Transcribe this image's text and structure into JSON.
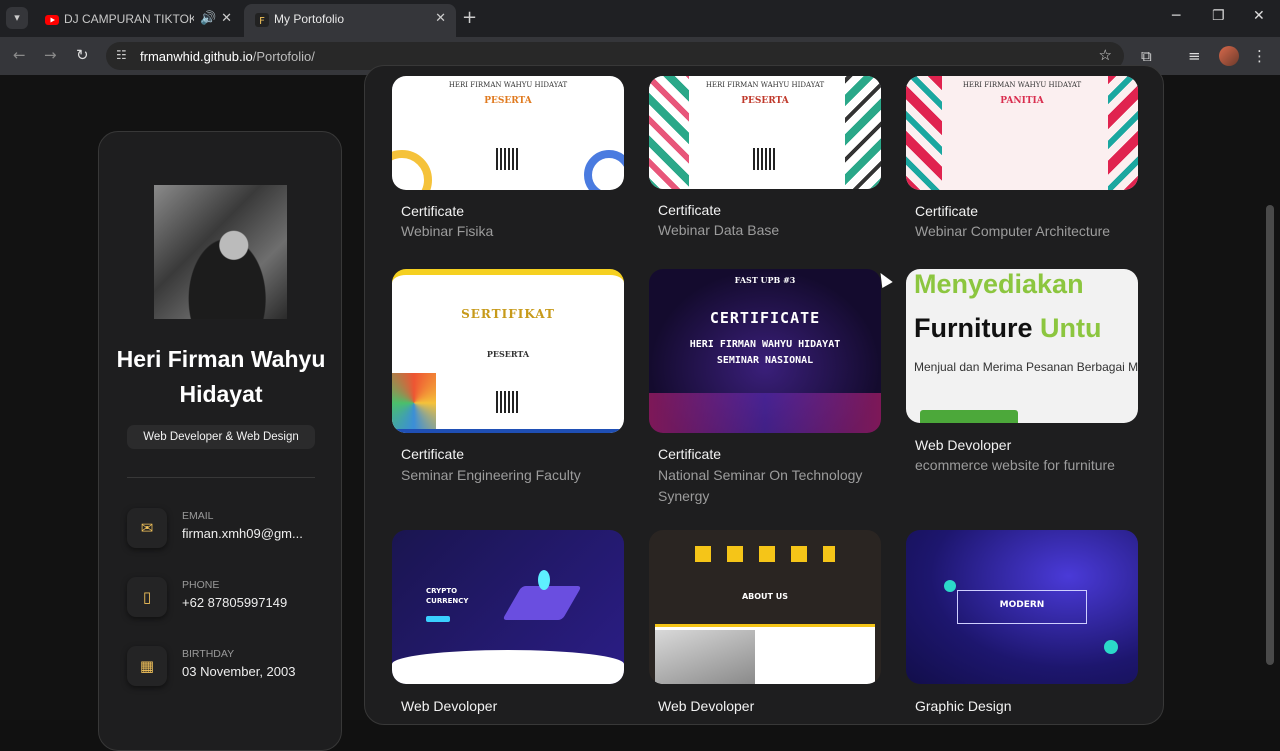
{
  "browser": {
    "tabs": [
      {
        "title": "DJ CAMPURAN TIKTOK TER",
        "active": false
      },
      {
        "title": "My Portofolio",
        "active": true
      }
    ],
    "url_host": "frmanwhid.github.io",
    "url_path": "/Portofolio/"
  },
  "profile": {
    "name": "Heri Firman Wahyu Hidayat",
    "role": "Web Developer & Web Design",
    "contacts": [
      {
        "label": "EMAIL",
        "value": "firman.xmh09@gm...",
        "icon": "mail-icon"
      },
      {
        "label": "PHONE",
        "value": "+62 87805997149",
        "icon": "phone-icon"
      },
      {
        "label": "BIRTHDAY",
        "value": "03 November, 2003",
        "icon": "calendar-icon"
      }
    ]
  },
  "portfolio": [
    {
      "category": "Certificate",
      "title": "Webinar Fisika"
    },
    {
      "category": "Certificate",
      "title": "Webinar Data Base"
    },
    {
      "category": "Certificate",
      "title": "Webinar Computer Architecture"
    },
    {
      "category": "Certificate",
      "title": "Seminar Engineering Faculty"
    },
    {
      "category": "Certificate",
      "title": "National Seminar On Technology Synergy"
    },
    {
      "category": "Web Devoloper",
      "title": "ecommerce website for furniture"
    },
    {
      "category": "Web Devoloper",
      "title": ""
    },
    {
      "category": "Web Devoloper",
      "title": ""
    },
    {
      "category": "Graphic Design",
      "title": ""
    }
  ],
  "thumbs": {
    "cert_name": "HERI FIRMAN WAHYU HIDAYAT",
    "peserta": "PESERTA",
    "panitia": "PANITIA",
    "sertifikat": "SERTIFIKAT",
    "fast_upb": "FAST UPB #3",
    "certificate_big": "CERTIFICATE",
    "seminar_nasional": "SEMINAR NASIONAL",
    "furniture_line1": "Menyediakan",
    "furniture_line2a": "Furniture",
    "furniture_line2b": "Untu",
    "furniture_sub": "Menjual dan Merima Pesanan Berbagai Macam-macam : Meja, Ku",
    "crypto": "CRYPTO CURRENCY",
    "about_us": "ABOUT US",
    "modern": "MODERN"
  }
}
